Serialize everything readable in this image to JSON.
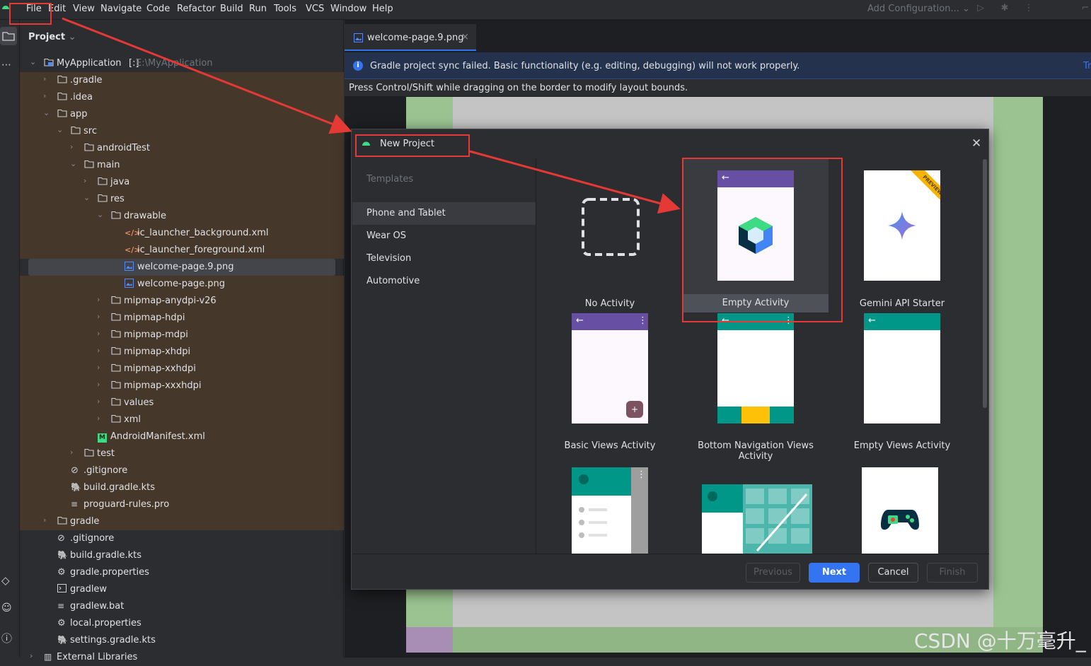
{
  "menubar": {
    "items": [
      "File",
      "Edit",
      "View",
      "Navigate",
      "Code",
      "Refactor",
      "Build",
      "Run",
      "Tools",
      "VCS",
      "Window",
      "Help"
    ],
    "add_configuration": "Add Configuration..."
  },
  "project_panel": {
    "title": "Project",
    "tree": [
      {
        "label": "MyApplication",
        "extra": "E:\\MyApplication",
        "module_mark": "[:]",
        "icon": "module-icon",
        "expanded": true
      },
      {
        "label": ".gradle",
        "icon": "folder-icon",
        "expanded": false
      },
      {
        "label": ".idea",
        "icon": "folder-icon",
        "expanded": false
      },
      {
        "label": "app",
        "icon": "folder-icon",
        "expanded": true
      },
      {
        "label": "src",
        "icon": "folder-icon",
        "expanded": true
      },
      {
        "label": "androidTest",
        "icon": "folder-icon",
        "expanded": false
      },
      {
        "label": "main",
        "icon": "folder-icon",
        "expanded": true
      },
      {
        "label": "java",
        "icon": "folder-icon",
        "expanded": false
      },
      {
        "label": "res",
        "icon": "folder-icon",
        "expanded": true
      },
      {
        "label": "drawable",
        "icon": "folder-icon",
        "expanded": true
      },
      {
        "label": "ic_launcher_background.xml",
        "icon": "xml-file-icon"
      },
      {
        "label": "ic_launcher_foreground.xml",
        "icon": "xml-file-icon"
      },
      {
        "label": "welcome-page.9.png",
        "icon": "image-file-icon",
        "selected": true
      },
      {
        "label": "welcome-page.png",
        "icon": "image-file-icon"
      },
      {
        "label": "mipmap-anydpi-v26",
        "icon": "folder-icon",
        "expanded": false
      },
      {
        "label": "mipmap-hdpi",
        "icon": "folder-icon",
        "expanded": false
      },
      {
        "label": "mipmap-mdpi",
        "icon": "folder-icon",
        "expanded": false
      },
      {
        "label": "mipmap-xhdpi",
        "icon": "folder-icon",
        "expanded": false
      },
      {
        "label": "mipmap-xxhdpi",
        "icon": "folder-icon",
        "expanded": false
      },
      {
        "label": "mipmap-xxxhdpi",
        "icon": "folder-icon",
        "expanded": false
      },
      {
        "label": "values",
        "icon": "folder-icon",
        "expanded": false
      },
      {
        "label": "xml",
        "icon": "folder-icon",
        "expanded": false
      },
      {
        "label": "AndroidManifest.xml",
        "icon": "manifest-file-icon"
      },
      {
        "label": "test",
        "icon": "folder-icon",
        "expanded": false
      },
      {
        "label": ".gitignore",
        "icon": "gitignore-icon"
      },
      {
        "label": "build.gradle.kts",
        "icon": "gradle-file-icon"
      },
      {
        "label": "proguard-rules.pro",
        "icon": "text-file-icon"
      },
      {
        "label": "gradle",
        "icon": "folder-icon",
        "expanded": false
      },
      {
        "label": ".gitignore",
        "icon": "gitignore-icon"
      },
      {
        "label": "build.gradle.kts",
        "icon": "gradle-file-icon"
      },
      {
        "label": "gradle.properties",
        "icon": "settings-file-icon"
      },
      {
        "label": "gradlew",
        "icon": "terminal-file-icon"
      },
      {
        "label": "gradlew.bat",
        "icon": "text-file-icon"
      },
      {
        "label": "local.properties",
        "icon": "settings-file-icon"
      },
      {
        "label": "settings.gradle.kts",
        "icon": "gradle-file-icon"
      },
      {
        "label": "External Libraries",
        "icon": "library-icon",
        "expanded": false
      }
    ]
  },
  "editor": {
    "tab_label": "welcome-page.9.png",
    "banner": "Gradle project sync failed. Basic functionality (e.g. editing, debugging) will not work properly.",
    "banner_right": "Tr",
    "hint": "Press Control/Shift while dragging on the border to modify layout bounds."
  },
  "dialog": {
    "title": "New Project",
    "templates_header": "Templates",
    "categories": [
      "Phone and Tablet",
      "Wear OS",
      "Television",
      "Automotive"
    ],
    "active_category": "Phone and Tablet",
    "templates": [
      "No Activity",
      "Empty Activity",
      "Gemini API Starter",
      "Basic Views Activity",
      "Bottom Navigation Views Activity",
      "Empty Views Activity"
    ],
    "selected_template": "Empty Activity",
    "preview_badge": "PREVIEW",
    "buttons": {
      "previous": "Previous",
      "next": "Next",
      "cancel": "Cancel",
      "finish": "Finish"
    }
  },
  "watermark": "CSDN @十万毫升_",
  "colors": {
    "accent": "#3574f0",
    "annotation_red": "#e53935",
    "excluded_bg": "#45372a"
  }
}
